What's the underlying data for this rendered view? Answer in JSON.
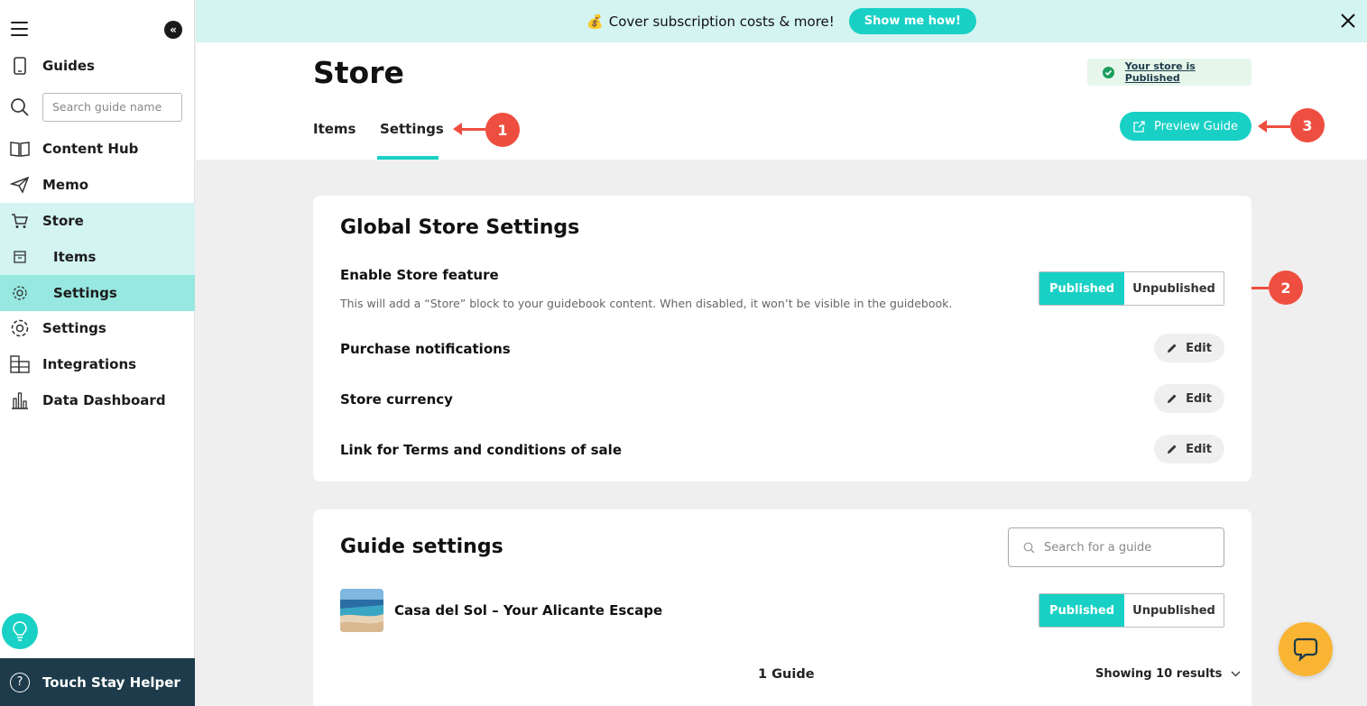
{
  "banner": {
    "emoji": "💰",
    "text": "Cover subscription costs & more!",
    "button_label": "Show me how!"
  },
  "sidebar": {
    "search_placeholder": "Search guide name",
    "items": [
      {
        "label": "Guides",
        "icon": "phone-icon"
      },
      {
        "label": "Content Hub",
        "icon": "book-icon"
      },
      {
        "label": "Memo",
        "icon": "paper-plane-icon"
      },
      {
        "label": "Store",
        "icon": "cart-icon"
      },
      {
        "label": "Items",
        "icon": "archive-icon"
      },
      {
        "label": "Settings",
        "icon": "gear-icon"
      },
      {
        "label": "Settings",
        "icon": "gear-icon"
      },
      {
        "label": "Integrations",
        "icon": "building-icon"
      },
      {
        "label": "Data Dashboard",
        "icon": "bar-chart-icon"
      }
    ],
    "helper_label": "Touch Stay Helper"
  },
  "header": {
    "title": "Store",
    "tabs": [
      {
        "label": "Items"
      },
      {
        "label": "Settings"
      }
    ],
    "published_badge": "Your store is Published",
    "preview_label": "Preview Guide"
  },
  "markers": {
    "one": "1",
    "two": "2",
    "three": "3"
  },
  "global_settings": {
    "title": "Global Store Settings",
    "enable_label": "Enable Store feature",
    "enable_desc": "This will add a “Store” block to your guidebook content. When disabled, it won’t be visible in the guidebook.",
    "published": "Published",
    "unpublished": "Unpublished",
    "rows": [
      {
        "label": "Purchase notifications",
        "edit": "Edit"
      },
      {
        "label": "Store currency",
        "edit": "Edit"
      },
      {
        "label": "Link for Terms and conditions of sale",
        "edit": "Edit"
      }
    ]
  },
  "guide_settings": {
    "title": "Guide settings",
    "search_placeholder": "Search for a guide",
    "guide_name": "Casa del Sol – Your Alicante Escape",
    "published": "Published",
    "unpublished": "Unpublished",
    "count": "1 Guide",
    "showing": "Showing 10 results"
  },
  "colors": {
    "accent": "#19d0c5",
    "marker": "#ee4e3f",
    "helper_bg": "#1d3b4a"
  }
}
